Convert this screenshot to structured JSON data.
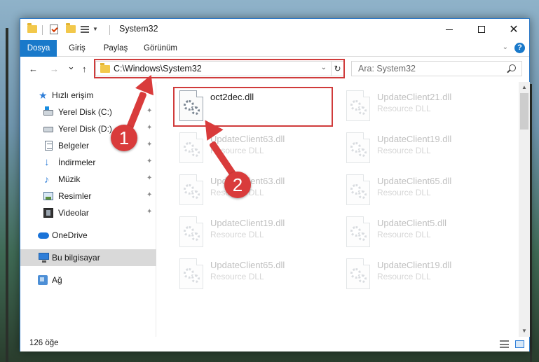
{
  "window": {
    "title": "System32",
    "controls": {
      "minimize": "—",
      "maximize": "☐",
      "close": "✕"
    }
  },
  "ribbon": {
    "tabs": [
      {
        "label": "Dosya",
        "active": true
      },
      {
        "label": "Giriş"
      },
      {
        "label": "Paylaş"
      },
      {
        "label": "Görünüm"
      }
    ],
    "help": "?"
  },
  "navigation": {
    "back": "←",
    "forward": "→",
    "recent": "⌄",
    "up": "↑",
    "address": "C:\\Windows\\System32",
    "refresh": "↻",
    "search_placeholder": "Ara: System32"
  },
  "sidebar": {
    "items": [
      {
        "label": "Hızlı erişim",
        "icon": "star-icon"
      },
      {
        "label": "Yerel Disk (C:)",
        "icon": "disk-c-icon",
        "pinned": true
      },
      {
        "label": "Yerel Disk (D:)",
        "icon": "disk-d-icon",
        "pinned": true
      },
      {
        "label": "Belgeler",
        "icon": "documents-icon",
        "pinned": true
      },
      {
        "label": "İndirmeler",
        "icon": "downloads-icon",
        "pinned": true
      },
      {
        "label": "Müzik",
        "icon": "music-icon",
        "pinned": true
      },
      {
        "label": "Resimler",
        "icon": "pictures-icon",
        "pinned": true
      },
      {
        "label": "Videolar",
        "icon": "videos-icon",
        "pinned": true
      },
      {
        "label": "OneDrive",
        "icon": "onedrive-icon"
      },
      {
        "label": "Bu bilgisayar",
        "icon": "this-pc-icon",
        "selected": true
      },
      {
        "label": "Ağ",
        "icon": "network-icon"
      }
    ],
    "pin_glyph": "📌"
  },
  "files": [
    {
      "name": "oct2dec.dll",
      "desc": ""
    },
    {
      "name": "UpdateClient21.dll",
      "desc": "Resource DLL"
    },
    {
      "name": "UpdateClient63.dll",
      "desc": "Resource DLL"
    },
    {
      "name": "UpdateClient19.dll",
      "desc": "Resource DLL"
    },
    {
      "name": "UpdateClient63.dll",
      "desc": "Resource DLL"
    },
    {
      "name": "UpdateClient65.dll",
      "desc": "Resource DLL"
    },
    {
      "name": "UpdateClient19.dll",
      "desc": "Resource DLL"
    },
    {
      "name": "UpdateClient5.dll",
      "desc": "Resource DLL"
    },
    {
      "name": "UpdateClient65.dll",
      "desc": "Resource DLL"
    },
    {
      "name": "UpdateClient19.dll",
      "desc": "Resource DLL"
    }
  ],
  "status": {
    "count": "126 öğe"
  },
  "scrollbar": {
    "up": "▲",
    "down": "▼"
  },
  "callouts": {
    "step1": "1",
    "step2": "2"
  },
  "colors": {
    "accent": "#1979ca",
    "highlight": "#d03b3b"
  }
}
